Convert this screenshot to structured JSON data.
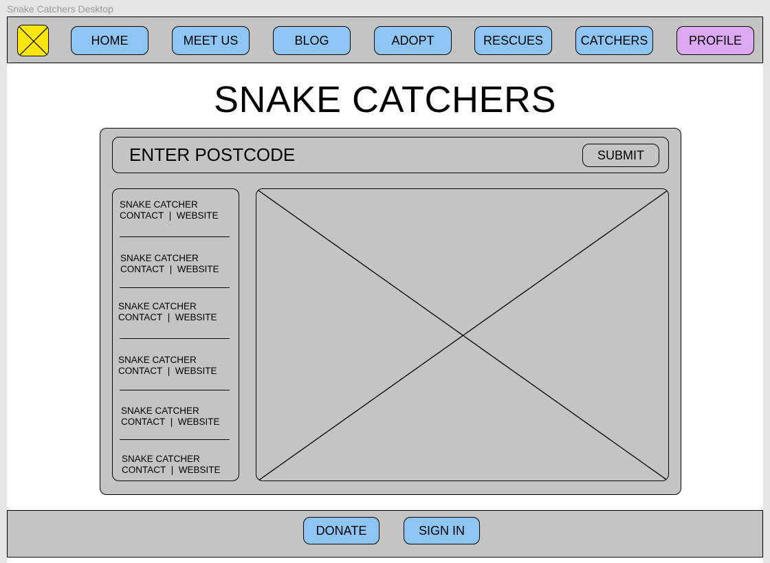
{
  "frame": {
    "label": "Snake Catchers Desktop"
  },
  "nav": {
    "logo_icon": "logo-placeholder-icon",
    "items": [
      {
        "label": "HOME"
      },
      {
        "label": "MEET US"
      },
      {
        "label": "BLOG"
      },
      {
        "label": "ADOPT"
      },
      {
        "label": "RESCUES"
      },
      {
        "label": "CATCHERS"
      },
      {
        "label": "PROFILE"
      }
    ]
  },
  "title": "SNAKE CATCHERS",
  "search": {
    "label": "ENTER POSTCODE",
    "submit_label": "SUBMIT"
  },
  "catchers": [
    {
      "name": "SNAKE CATCHER",
      "contact": "CONTACT",
      "sep": "|",
      "website": "WEBSITE"
    },
    {
      "name": "SNAKE CATCHER",
      "contact": "CONTACT",
      "sep": "|",
      "website": "WEBSITE"
    },
    {
      "name": "SNAKE CATCHER",
      "contact": "CONTACT",
      "sep": "|",
      "website": "WEBSITE"
    },
    {
      "name": "SNAKE CATCHER",
      "contact": "CONTACT",
      "sep": "|",
      "website": "WEBSITE"
    },
    {
      "name": "SNAKE CATCHER",
      "contact": "CONTACT",
      "sep": "|",
      "website": "WEBSITE"
    },
    {
      "name": "SNAKE CATCHER",
      "contact": "CONTACT",
      "sep": "|",
      "website": "WEBSITE"
    }
  ],
  "map": {
    "icon": "image-placeholder-icon"
  },
  "footer": {
    "items": [
      {
        "label": "DONATE"
      },
      {
        "label": "SIGN IN"
      }
    ]
  },
  "colors": {
    "nav_button": "#8ec5f2",
    "profile_button": "#dba8f1",
    "logo": "#fbe50f",
    "panel": "#c4c4c4"
  }
}
